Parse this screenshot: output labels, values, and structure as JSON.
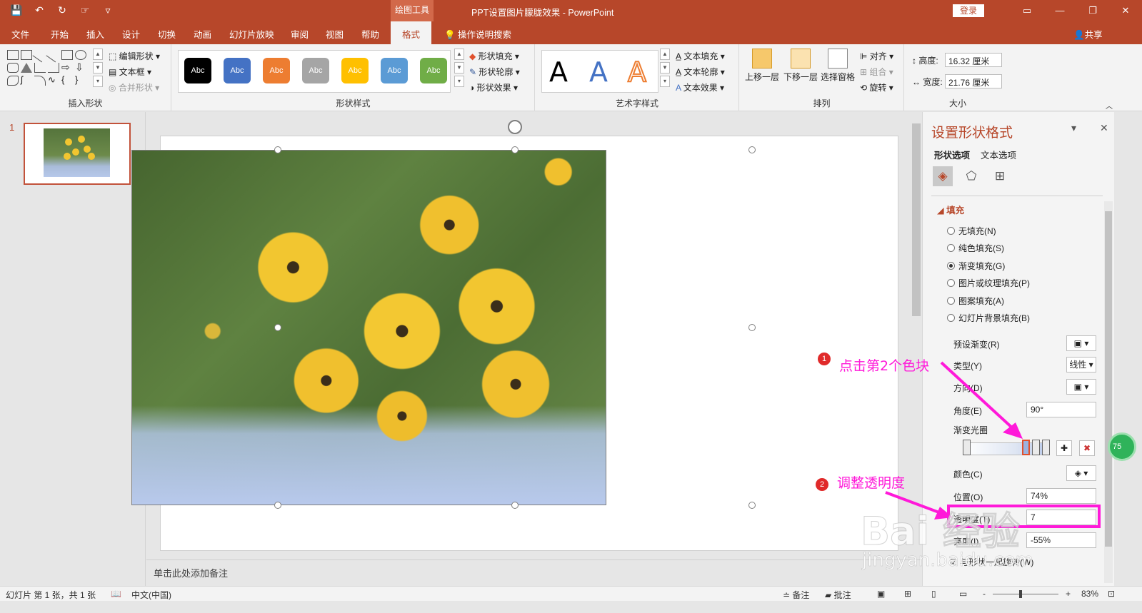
{
  "titlebar": {
    "context_tool": "绘图工具",
    "doc_title": "PPT设置图片朦胧效果  -  PowerPoint",
    "login": "登录",
    "qat_icons": [
      "save-icon",
      "undo-icon",
      "redo-icon",
      "touch-mode-icon",
      "customize-icon"
    ]
  },
  "tabs": [
    {
      "label": "文件"
    },
    {
      "label": "开始"
    },
    {
      "label": "插入"
    },
    {
      "label": "设计"
    },
    {
      "label": "切换"
    },
    {
      "label": "动画"
    },
    {
      "label": "幻灯片放映"
    },
    {
      "label": "审阅"
    },
    {
      "label": "视图"
    },
    {
      "label": "帮助"
    },
    {
      "label": "格式",
      "active": true
    }
  ],
  "search_tab": "操作说明搜索",
  "share": "共享",
  "ribbon": {
    "insert_shapes": {
      "label": "插入形状",
      "edit_shape": "编辑形状",
      "text_box": "文本框",
      "merge_shapes": "合并形状"
    },
    "shape_styles": {
      "label": "形状样式",
      "swatch_text": "Abc",
      "swatches": [
        "#000000",
        "#4472c4",
        "#ed7d31",
        "#a5a5a5",
        "#ffc000",
        "#5b9bd5",
        "#70ad47"
      ],
      "fill": "形状填充",
      "outline": "形状轮廓",
      "effects": "形状效果"
    },
    "wordart": {
      "label": "艺术字样式",
      "sample": "A",
      "text_fill": "文本填充",
      "text_outline": "文本轮廓",
      "text_effects": "文本效果"
    },
    "arrange": {
      "label": "排列",
      "bring_forward": "上移一层",
      "send_backward": "下移一层",
      "selection_pane": "选择窗格",
      "align": "对齐",
      "group": "组合",
      "rotate": "旋转"
    },
    "size": {
      "label": "大小",
      "height_label": "高度:",
      "height_value": "16.32 厘米",
      "width_label": "宽度:",
      "width_value": "21.76 厘米"
    }
  },
  "thumbs": {
    "slide_number": "1"
  },
  "notes_placeholder": "单击此处添加备注",
  "pane": {
    "title": "设置形状格式",
    "tab_shape": "形状选项",
    "tab_text": "文本选项",
    "section": "填充",
    "fill_options": [
      {
        "label": "无填充(N)",
        "checked": false
      },
      {
        "label": "纯色填充(S)",
        "checked": false
      },
      {
        "label": "渐变填充(G)",
        "checked": true
      },
      {
        "label": "图片或纹理填充(P)",
        "checked": false
      },
      {
        "label": "图案填充(A)",
        "checked": false
      },
      {
        "label": "幻灯片背景填充(B)",
        "checked": false
      }
    ],
    "preset_gradient": "预设渐变(R)",
    "type_label": "类型(Y)",
    "type_value": "线性",
    "direction_label": "方向(D)",
    "angle_label": "角度(E)",
    "angle_value": "90°",
    "gradient_stops": "渐变光圈",
    "color_label": "颜色(C)",
    "position_label": "位置(O)",
    "position_value": "74%",
    "transparency_label": "透明度(T)",
    "transparency_value": "7",
    "brightness_label": "亮度(I)",
    "brightness_value": "-55%",
    "rotate_with_shape": "与形状一起旋转(W)"
  },
  "annotations": {
    "step1_num": "1",
    "step1_text": "点击第2个色块",
    "step2_num": "2",
    "step2_text": "调整透明度",
    "watermark": "Bai 经验",
    "watermark_url": "jingyan.baidu.com",
    "badge": "75"
  },
  "statusbar": {
    "slide_info": "幻灯片 第 1 张，共 1 张",
    "language": "中文(中国)",
    "notes": "备注",
    "comments": "批注",
    "zoom": "83%",
    "minus": "-",
    "plus": "+"
  },
  "colors": {
    "accent": "#b7472a",
    "annotation": "#ff19d9"
  }
}
